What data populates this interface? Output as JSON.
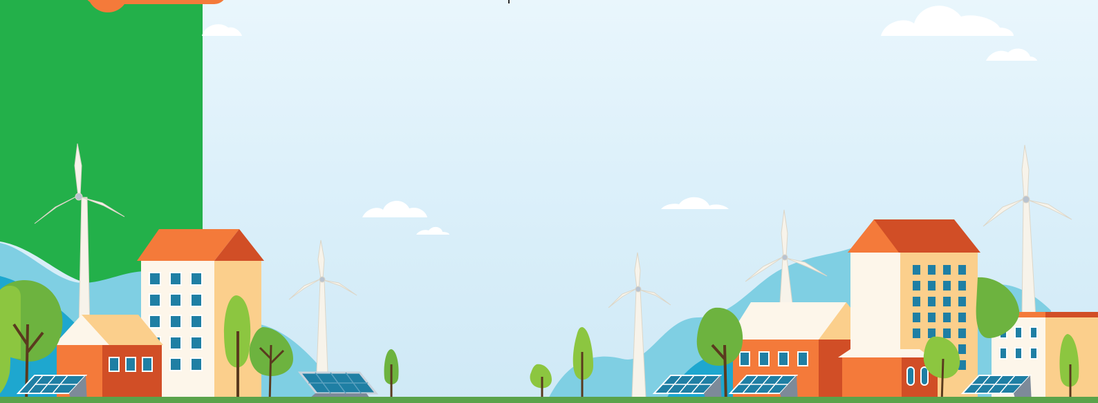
{
  "scene": {
    "description_name": "green-city-banner",
    "colors": {
      "sky_top": "#e9f6fc",
      "sky_bottom": "#cfe9f6",
      "panel_green": "#23b04a",
      "accent_orange": "#f47a3a",
      "brick_red": "#d14e26",
      "cream": "#fdf6ea",
      "sand": "#fbcf8c",
      "window_teal": "#1f7fa4",
      "hill_light": "#7fcfe3",
      "hill_dark": "#1ea7cf",
      "tree_green": "#6db33f",
      "ground": "#5aa34a"
    },
    "icons": [
      "lightbulb-icon"
    ]
  }
}
